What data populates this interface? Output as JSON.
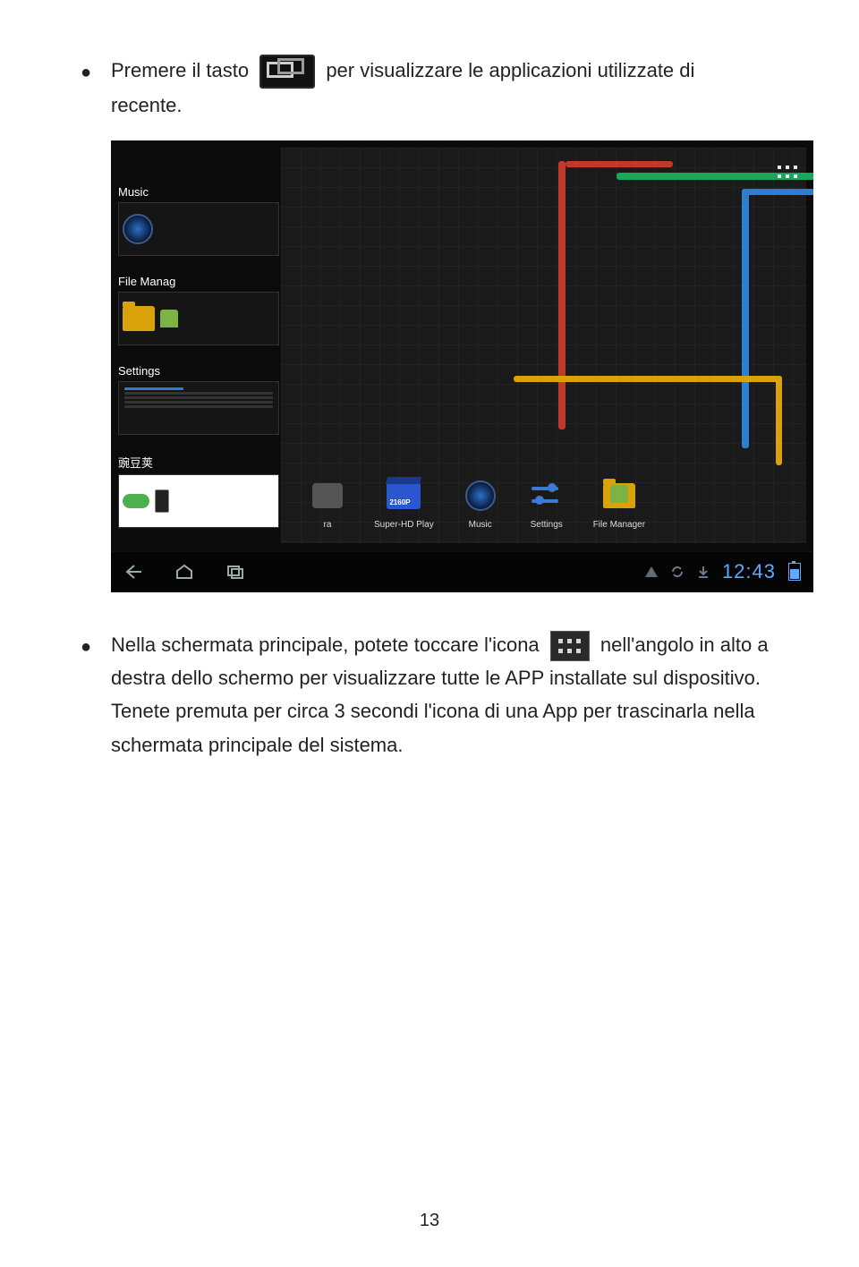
{
  "page_number": "13",
  "para1": {
    "a": "Premere il tasto",
    "b": "per visualizzare le applicazioni utilizzate di",
    "c": "recente."
  },
  "para2": {
    "a": "Nella schermata principale, potete toccare l'icona",
    "b": "nell'angolo in alto",
    "c": "a destra dello schermo per visualizzare tutte le APP installate sul dispositivo. Tenete premuta per circa 3 secondi l'icona di una App per trascinarla nella schermata principale del sistema."
  },
  "shot": {
    "recent": [
      {
        "label": "Music"
      },
      {
        "label": "File Manag"
      },
      {
        "label": "Settings"
      },
      {
        "label": "豌豆荚"
      }
    ],
    "dock": [
      {
        "label": "ra"
      },
      {
        "label": "Super-HD Play",
        "sub": "2160P"
      },
      {
        "label": "Music"
      },
      {
        "label": "Settings"
      },
      {
        "label": "File Manager"
      }
    ],
    "clock": "12:43"
  }
}
